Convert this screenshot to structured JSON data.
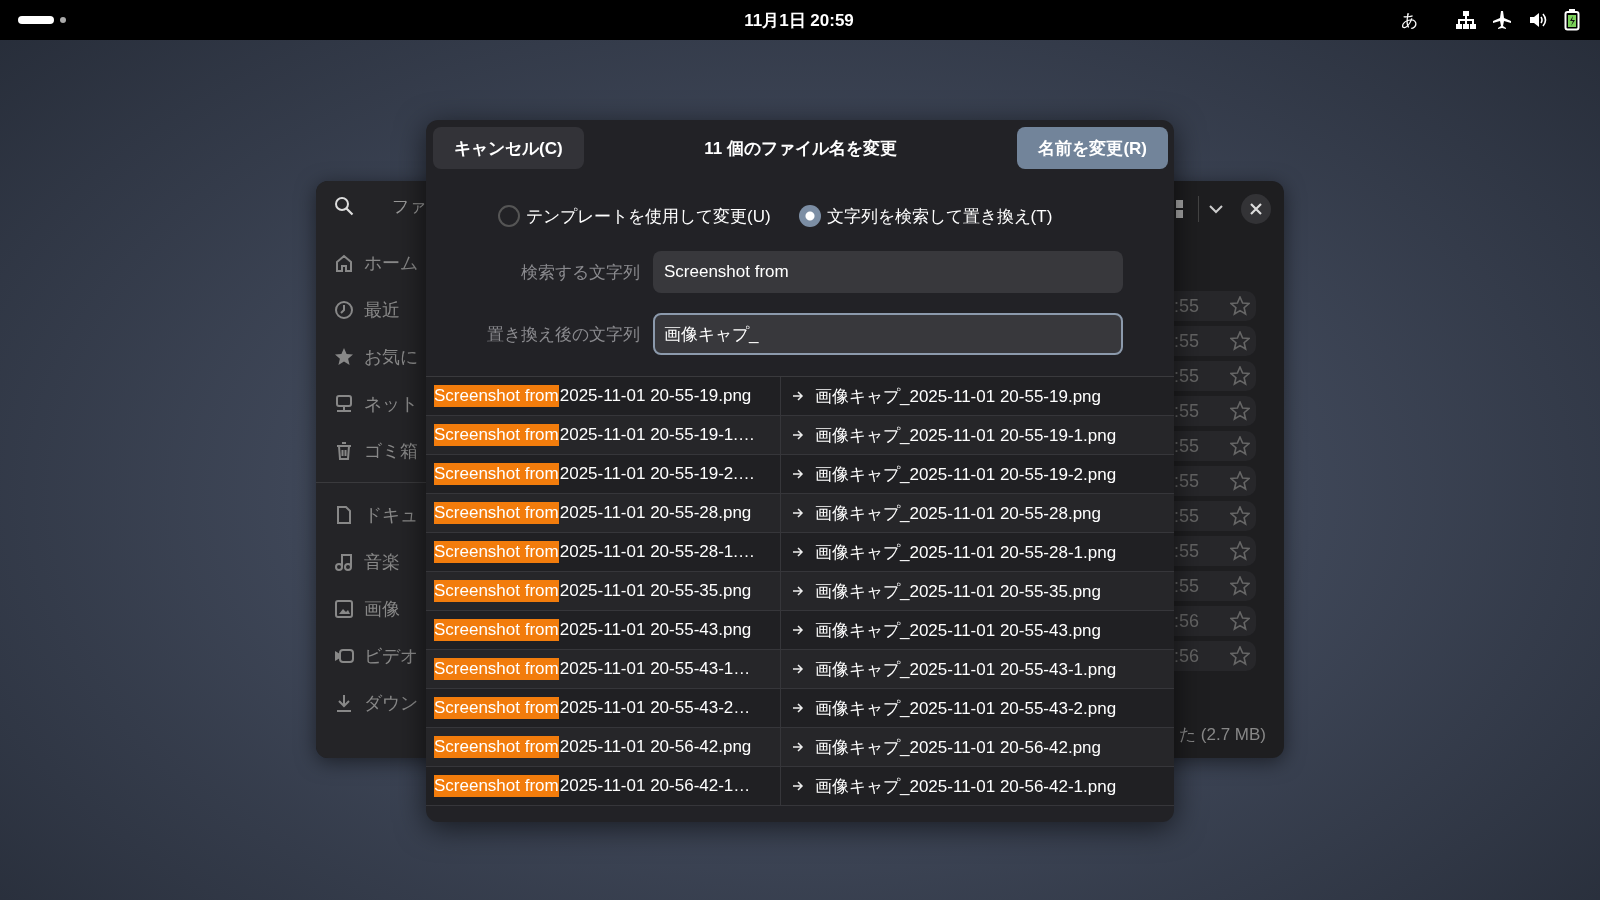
{
  "top_bar": {
    "clock": "11月1日 20:59",
    "input_method": "あ"
  },
  "background_window": {
    "search_text": "ファ",
    "sidebar_groups": [
      [
        {
          "label": "ホーム",
          "kind": "home"
        },
        {
          "label": "最近",
          "kind": "recent"
        },
        {
          "label": "お気に",
          "kind": "starred"
        },
        {
          "label": "ネット",
          "kind": "network"
        },
        {
          "label": "ゴミ箱",
          "kind": "trash"
        }
      ],
      [
        {
          "label": "ドキュ",
          "kind": "document"
        },
        {
          "label": "音楽",
          "kind": "music"
        },
        {
          "label": "画像",
          "kind": "picture"
        },
        {
          "label": "ビデオ",
          "kind": "video"
        },
        {
          "label": "ダウン",
          "kind": "download"
        }
      ]
    ],
    "file_rows": [
      {
        "time": ":55",
        "starred": false
      },
      {
        "time": ":55",
        "starred": false
      },
      {
        "time": ":55",
        "starred": false
      },
      {
        "time": ":55",
        "starred": false
      },
      {
        "time": ":55",
        "starred": false
      },
      {
        "time": ":55",
        "starred": false
      },
      {
        "time": ":55",
        "starred": false
      },
      {
        "time": ":55",
        "starred": false
      },
      {
        "time": ":55",
        "starred": false
      },
      {
        "time": ":56",
        "starred": false
      },
      {
        "time": ":56",
        "starred": false
      }
    ],
    "footer": "た (2.7 MB)"
  },
  "dialog": {
    "cancel_button": "キャンセル(C)",
    "title": "11 個のファイル名を変更",
    "rename_button": "名前を変更(R)",
    "modes": [
      {
        "label": "テンプレートを使用して変更(U)",
        "selected": false
      },
      {
        "label": "文字列を検索して置き換え(T)",
        "selected": true
      }
    ],
    "search": {
      "label": "検索する文字列",
      "value": "Screenshot from"
    },
    "replace": {
      "label": "置き換え後の文字列",
      "value": "画像キャプ_"
    },
    "files": [
      {
        "match": "Screenshot from",
        "rest": "2025-11-01 20-55-19.png",
        "new_name": "画像キャプ_2025-11-01 20-55-19.png"
      },
      {
        "match": "Screenshot from",
        "rest": "2025-11-01 20-55-19-1.…",
        "new_name": "画像キャプ_2025-11-01 20-55-19-1.png"
      },
      {
        "match": "Screenshot from",
        "rest": "2025-11-01 20-55-19-2.…",
        "new_name": "画像キャプ_2025-11-01 20-55-19-2.png"
      },
      {
        "match": "Screenshot from",
        "rest": "2025-11-01 20-55-28.png",
        "new_name": "画像キャプ_2025-11-01 20-55-28.png"
      },
      {
        "match": "Screenshot from",
        "rest": "2025-11-01 20-55-28-1.…",
        "new_name": "画像キャプ_2025-11-01 20-55-28-1.png"
      },
      {
        "match": "Screenshot from",
        "rest": "2025-11-01 20-55-35.png",
        "new_name": "画像キャプ_2025-11-01 20-55-35.png"
      },
      {
        "match": "Screenshot from",
        "rest": "2025-11-01 20-55-43.png",
        "new_name": "画像キャプ_2025-11-01 20-55-43.png"
      },
      {
        "match": "Screenshot from",
        "rest": "2025-11-01 20-55-43-1…",
        "new_name": "画像キャプ_2025-11-01 20-55-43-1.png"
      },
      {
        "match": "Screenshot from",
        "rest": "2025-11-01 20-55-43-2…",
        "new_name": "画像キャプ_2025-11-01 20-55-43-2.png"
      },
      {
        "match": "Screenshot from",
        "rest": "2025-11-01 20-56-42.png",
        "new_name": "画像キャプ_2025-11-01 20-56-42.png"
      },
      {
        "match": "Screenshot from",
        "rest": "2025-11-01 20-56-42-1…",
        "new_name": "画像キャプ_2025-11-01 20-56-42-1.png"
      }
    ]
  }
}
